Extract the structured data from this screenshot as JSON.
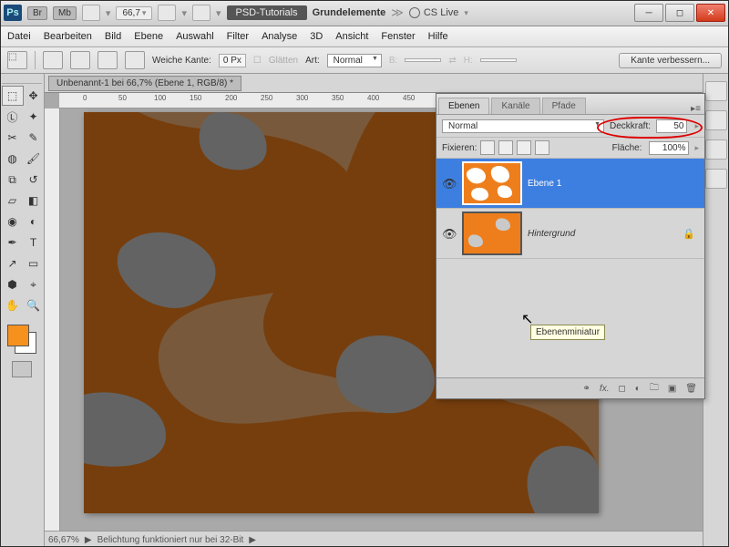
{
  "titlebar": {
    "app": "Ps",
    "chips": [
      "Br",
      "Mb"
    ],
    "zoom": "66,7",
    "psd_tut": "PSD-Tutorials",
    "doc_group": "Grundelemente",
    "cslive": "CS Live"
  },
  "menus": [
    "Datei",
    "Bearbeiten",
    "Bild",
    "Ebene",
    "Auswahl",
    "Filter",
    "Analyse",
    "3D",
    "Ansicht",
    "Fenster",
    "Hilfe"
  ],
  "options": {
    "feather_label": "Weiche Kante:",
    "feather_value": "0 Px",
    "antialias": "Glätten",
    "style_label": "Art:",
    "style_value": "Normal",
    "width_label": "B:",
    "height_label": "H:",
    "refine": "Kante verbessern..."
  },
  "doc_tab": "Unbenannt-1 bei 66,7% (Ebene 1, RGB/8) *",
  "ruler_marks": [
    "0",
    "50",
    "100",
    "150",
    "200",
    "250",
    "300",
    "350",
    "400",
    "450"
  ],
  "status": {
    "zoom": "66,67%",
    "msg": "Belichtung funktioniert nur bei 32-Bit"
  },
  "layers": {
    "tabs": [
      "Ebenen",
      "Kanäle",
      "Pfade"
    ],
    "blend": "Normal",
    "opacity_label": "Deckkraft:",
    "opacity_value": "50",
    "lock_label": "Fixieren:",
    "fill_label": "Fläche:",
    "fill_value": "100%",
    "items": [
      {
        "name": "Ebene 1",
        "selected": true,
        "locked": false,
        "italic": false
      },
      {
        "name": "Hintergrund",
        "selected": false,
        "locked": true,
        "italic": true
      }
    ],
    "tooltip": "Ebenenminiatur"
  }
}
